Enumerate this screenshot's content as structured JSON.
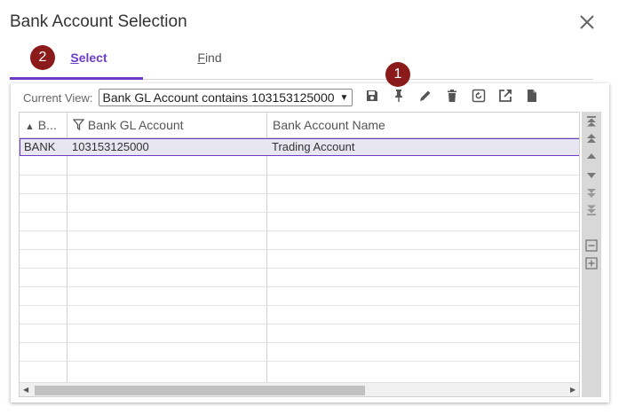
{
  "dialog": {
    "title": "Bank Account Selection",
    "close_icon": "close-icon"
  },
  "tabs": [
    {
      "label_accel": "S",
      "label_rest": "elect",
      "active": true
    },
    {
      "label_accel": "F",
      "label_rest": "ind",
      "active": false
    }
  ],
  "badges": {
    "select_step": "2",
    "pin_step": "1"
  },
  "view": {
    "label": "Current View:",
    "selected": "Bank GL Account contains 103153125000"
  },
  "toolbar_icons": [
    "save-icon",
    "pin-icon",
    "pencil-icon",
    "trash-icon",
    "refresh-icon",
    "export-icon",
    "document-icon"
  ],
  "table": {
    "columns": [
      {
        "label": "B...",
        "icon": "sort-up-icon"
      },
      {
        "label": "Bank GL Account",
        "icon": "filter-icon"
      },
      {
        "label": "Bank Account Name",
        "icon": ""
      }
    ],
    "rows": [
      {
        "bank": "BANK",
        "gl_account": "103153125000",
        "account_name": "Trading Account",
        "selected": true
      }
    ]
  },
  "sidebar_icons": [
    "first-icon",
    "page-up-icon",
    "up-icon",
    "down-icon",
    "page-down-icon",
    "last-icon",
    "collapse-icon",
    "expand-icon"
  ],
  "colors": {
    "accent": "#6c3bc9",
    "badge": "#8b1a1a",
    "selected_row": "#e8e6f0"
  }
}
